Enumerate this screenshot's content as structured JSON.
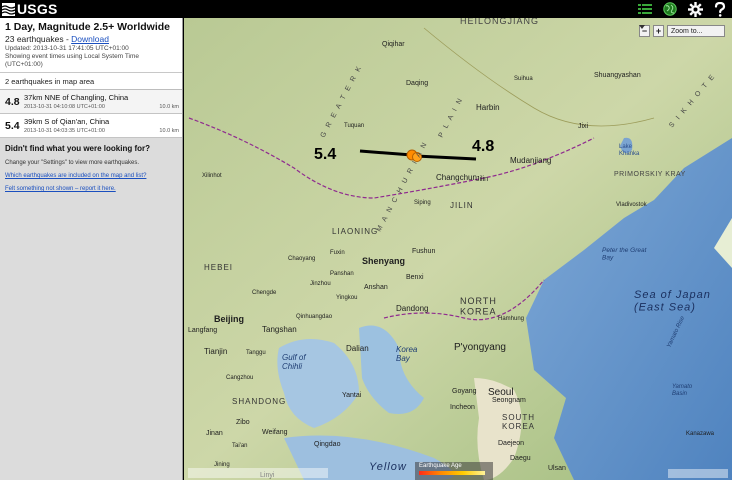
{
  "header": {
    "logo_text": "USGS",
    "icons": [
      "list-icon",
      "globe-icon",
      "gear-icon",
      "help-icon"
    ]
  },
  "sidebar": {
    "title": "1 Day, Magnitude 2.5+ Worldwide",
    "count_text": "23 earthquakes - ",
    "download_label": "Download",
    "updated": "Updated: 2013-10-31 17:41:05 UTC+01:00",
    "timezone_note": "Showing event times using Local System Time (UTC+01:00)",
    "in_area": "2 earthquakes in map area",
    "earthquakes": [
      {
        "mag": "4.8",
        "place": "37km NNE of Changling, China",
        "time": "2013-10-31 04:10:08 UTC+01:00",
        "depth": "10.0 km"
      },
      {
        "mag": "5.4",
        "place": "39km S of Qian'an, China",
        "time": "2013-10-31 04:03:35 UTC+01:00",
        "depth": "10.0 km"
      }
    ],
    "help_title": "Didn't find what you were looking for?",
    "help_text": "Change your \"Settings\" to view more earthquakes.",
    "help_link_1": "Which earthquakes are included on the map and list?",
    "help_link_2": "Felt something not shown – report it here."
  },
  "map": {
    "zoom_in": "+",
    "zoom_out": "−",
    "zoom_to_label": "Zoom to...",
    "legend_title": "Earthquake Age",
    "callout_left": "5.4",
    "callout_right": "4.8",
    "labels": {
      "heilongjiang": "HEILONGJIANG",
      "qiqihar": "Qiqihar",
      "daqing": "Daqing",
      "harbin": "Harbin",
      "suihua": "Suihua",
      "shuangyashan": "Shuangyashan",
      "jixi": "Jixi",
      "mudanjiang": "Mudanjiang",
      "lake_khanka": "Lake\nKhanka",
      "primorskiy": "PRIMORSKIY KRAY",
      "sikhote": "S I K H O T E",
      "tuquan": "Tuquan",
      "changchun": "Changchun",
      "jilin_city": "Jilin",
      "jilin_prov": "JILIN",
      "siping": "Siping",
      "xilinhot": "Xilinhot",
      "greater": "G R E A T E R  K",
      "manchurian": "M A N C H U R I A N",
      "plain": "P L A I N",
      "vladivostok": "Vladivostok",
      "peter_bay": "Peter the Great\nBay",
      "liaoning": "LIAONING",
      "fuxin": "Fuxin",
      "shenyang": "Shenyang",
      "fushun": "Fushun",
      "benxi": "Benxi",
      "chaoyang": "Chaoyang",
      "panshan": "Panshan",
      "jinzhou": "Jinzhou",
      "anshan": "Anshan",
      "yingkou": "Yingkou",
      "hebei": "HEBEI",
      "chengde": "Chengde",
      "dandong": "Dandong",
      "north_korea": "NORTH\nKOREA",
      "hamhung": "Hamhung",
      "sea_japan": "Sea of Japan\n(East Sea)",
      "beijing": "Beijing",
      "tangshan": "Tangshan",
      "qinhuangdao": "Qinhuangdao",
      "langfang": "Langfang",
      "tianjin": "Tianjin",
      "tanggu": "Tanggu",
      "gulf_chihli": "Gulf of\nChihli",
      "dalian": "Dalian",
      "korea_bay": "Korea\nBay",
      "pyongyang": "P'yongyang",
      "cangzhou": "Cangzhou",
      "yantai": "Yantai",
      "shandong": "SHANDONG",
      "seoul": "Seoul",
      "goyang": "Goyang",
      "incheon": "Incheon",
      "seongnam": "Seongnam",
      "south_korea": "SOUTH\nKOREA",
      "zibo": "Zibo",
      "weifang": "Weifang",
      "jinan": "Jinan",
      "taian": "Tai'an",
      "qingdao": "Qingdao",
      "jining": "Jining",
      "linyi": "Linyi",
      "yellow": "Yellow",
      "daejeon": "Daejeon",
      "daegu": "Daegu",
      "ulsan": "Ulsan",
      "yamato_rise": "Yamato Rise",
      "yamato_basin": "Yamato\nBasin",
      "kanazawa": "Kanazawa"
    }
  },
  "colors": {
    "land": "#c9d6a4",
    "water_shallow": "#a9c8e6",
    "water_deep": "#5e8fc5",
    "boundary": "#8f2b8f",
    "quake": "#ff8c00"
  }
}
